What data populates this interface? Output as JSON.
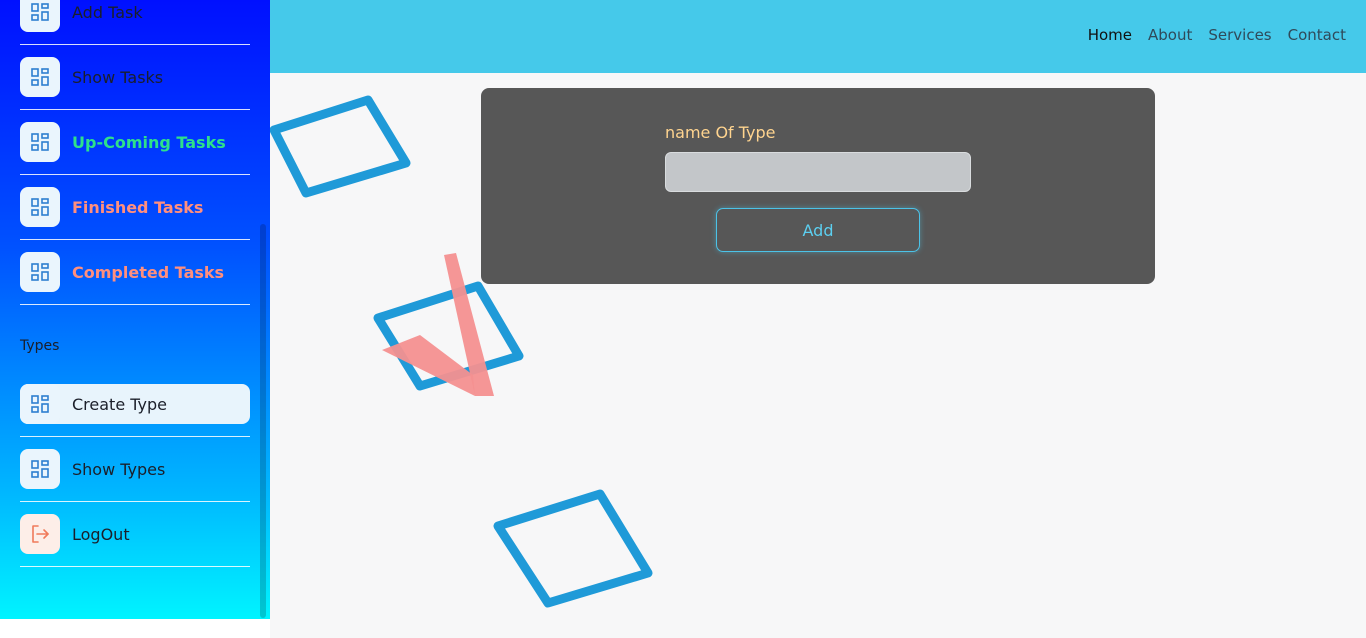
{
  "sidebar": {
    "items": [
      {
        "label": "Add Task",
        "icon": "dashboard-icon"
      },
      {
        "label": "Show Tasks",
        "icon": "dashboard-icon"
      },
      {
        "label": "Up-Coming Tasks",
        "icon": "dashboard-icon"
      },
      {
        "label": "Finished Tasks",
        "icon": "dashboard-icon"
      },
      {
        "label": "Completed Tasks",
        "icon": "dashboard-icon"
      }
    ],
    "types_section_title": "Types",
    "type_items": [
      {
        "label": "Create Type",
        "icon": "dashboard-icon"
      },
      {
        "label": "Show Types",
        "icon": "dashboard-icon"
      },
      {
        "label": "LogOut",
        "icon": "logout-icon"
      }
    ]
  },
  "topnav": {
    "home": "Home",
    "about": "About",
    "services": "Services",
    "contact": "Contact"
  },
  "form": {
    "label": "name Of Type",
    "value": "",
    "submit_label": "Add"
  },
  "colors": {
    "topbar": "#45c9ea",
    "card": "#575757",
    "accent": "#4cc3e8",
    "label": "#ffd48f",
    "green": "#2ee08a",
    "salmon": "#ff8f7e"
  }
}
